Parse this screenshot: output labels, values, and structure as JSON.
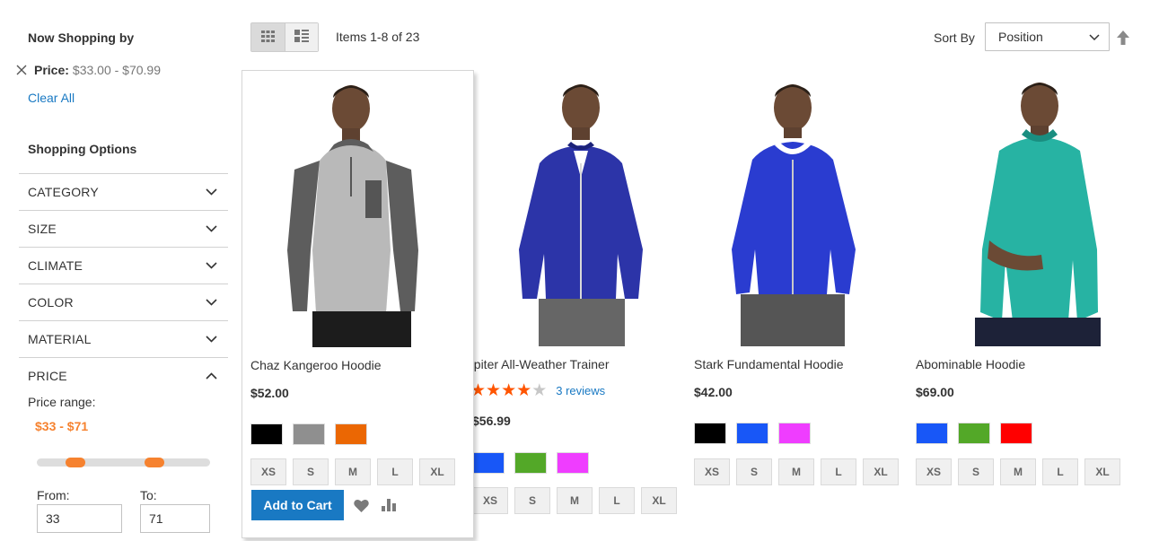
{
  "sidebar": {
    "now_title": "Now Shopping by",
    "active_filter": {
      "label": "Price:",
      "value": "$33.00 - $70.99"
    },
    "clear_all": "Clear All",
    "options_title": "Shopping Options",
    "filters": [
      {
        "label": "CATEGORY",
        "state": "collapsed"
      },
      {
        "label": "SIZE",
        "state": "collapsed"
      },
      {
        "label": "CLIMATE",
        "state": "collapsed"
      },
      {
        "label": "COLOR",
        "state": "collapsed"
      },
      {
        "label": "MATERIAL",
        "state": "collapsed"
      },
      {
        "label": "PRICE",
        "state": "expanded"
      }
    ],
    "price": {
      "range_label": "Price range:",
      "range_value": "$33 - $71",
      "from_label": "From:",
      "to_label": "To:",
      "from_value": "33",
      "to_value": "71",
      "accent": "#f6822f"
    }
  },
  "toolbar": {
    "items_count": "Items 1-8 of 23",
    "sort_label": "Sort By",
    "sort_value": "Position",
    "modes": [
      "grid-icon",
      "list-icon"
    ]
  },
  "products": [
    {
      "name": "Chaz Kangeroo Hoodie",
      "price": "$52.00",
      "swatches": [
        "#000000",
        "#8f8f8f",
        "#eb6703"
      ],
      "sizes": [
        "XS",
        "S",
        "M",
        "L",
        "XL"
      ],
      "add_to_cart": "Add to Cart"
    },
    {
      "name": "Jupiter All-Weather Trainer",
      "price": "$56.99",
      "rating": 4,
      "reviews": "3 reviews",
      "swatches": [
        "#1857f7",
        "#53a828",
        "#ef3dff"
      ],
      "sizes": [
        "XS",
        "S",
        "M",
        "L",
        "XL"
      ]
    },
    {
      "name": "Stark Fundamental Hoodie",
      "price": "$42.00",
      "swatches": [
        "#000000",
        "#1857f7",
        "#ef3dff"
      ],
      "sizes": [
        "XS",
        "S",
        "M",
        "L",
        "XL"
      ]
    },
    {
      "name": "Abominable Hoodie",
      "price": "$69.00",
      "swatches": [
        "#1857f7",
        "#53a828",
        "#ff0000"
      ],
      "sizes": [
        "XS",
        "S",
        "M",
        "L",
        "XL"
      ]
    }
  ],
  "colors": {
    "link": "#1979c3",
    "star": "#ff5501",
    "star_empty": "#c7c7c7"
  }
}
